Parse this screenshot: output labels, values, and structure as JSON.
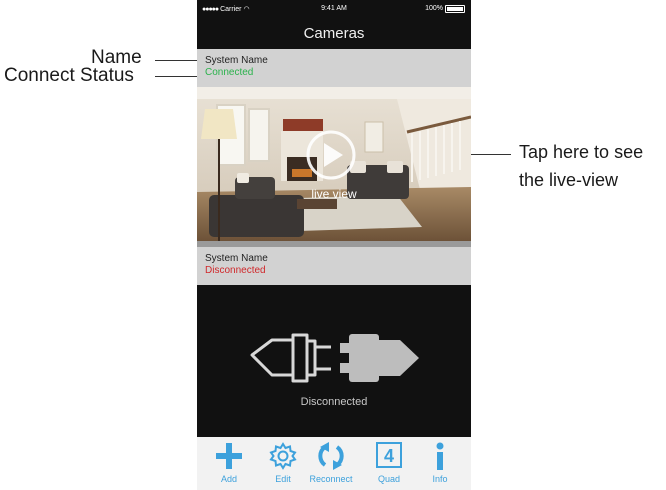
{
  "annotations": {
    "name": "Name",
    "connect_status": "Connect Status",
    "tap_line1": "Tap here to see",
    "tap_line2": "the live-view"
  },
  "status_bar": {
    "carrier": "Carrier",
    "time": "9:41 AM",
    "battery": "100%"
  },
  "nav": {
    "title": "Cameras"
  },
  "cameras": [
    {
      "name": "System Name",
      "status": "Connected",
      "status_color": "#2bb24c",
      "overlay_label": "live view"
    },
    {
      "name": "System Name",
      "status": "Disconnected",
      "status_color": "#d0282b",
      "panel_label": "Disconnected"
    }
  ],
  "tabbar": {
    "accent_color": "#3da1dc",
    "items": [
      {
        "label": "Add",
        "icon": "plus-icon"
      },
      {
        "label": "Edit",
        "icon": "gear-icon"
      },
      {
        "label": "Reconnect",
        "icon": "refresh-icon"
      },
      {
        "label": "Quad",
        "icon": "quad-4-icon",
        "glyph": "4"
      },
      {
        "label": "Info",
        "icon": "info-icon"
      }
    ]
  }
}
